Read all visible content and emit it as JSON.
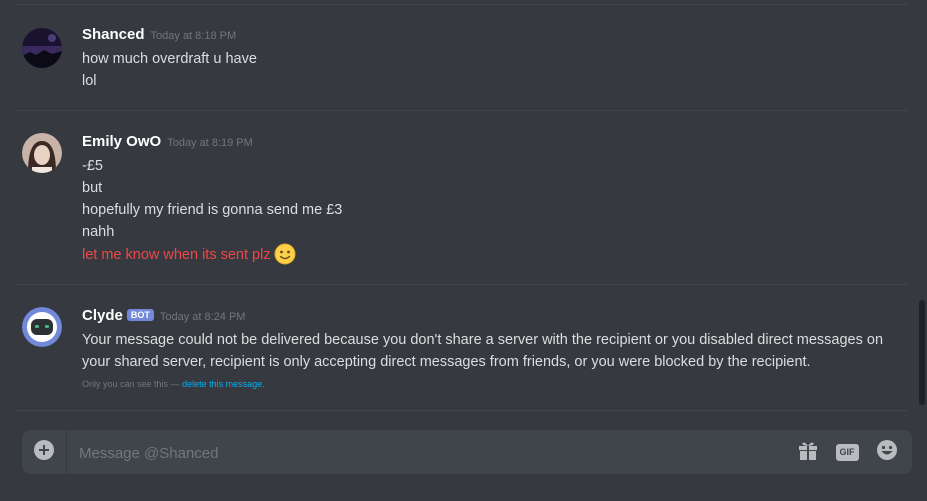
{
  "messages": [
    {
      "username": "Shanced",
      "timestamp": "Today at 8:18 PM",
      "lines": [
        "how much overdraft u have",
        "lol"
      ]
    },
    {
      "username": "Emily OwO",
      "timestamp": "Today at 8:19 PM",
      "lines": [
        "-£5",
        "but",
        "hopefully my friend is gonna send me £3",
        "nahh"
      ],
      "highlight_line": "let me know when its sent plz",
      "emoji": "slightly-smiling-face-icon"
    },
    {
      "username": "Clyde",
      "bot_tag": "BOT",
      "timestamp": "Today at 8:24 PM",
      "text": "Your message could not be delivered because you don't share a server with the recipient or you disabled direct messages on your shared server, recipient is only accepting direct messages from friends, or you were blocked by the recipient.",
      "ephemeral_note": "Only you can see this —",
      "ephemeral_link": "delete this message."
    }
  ],
  "composer": {
    "placeholder": "Message @Shanced",
    "gif_label": "GIF",
    "icons": [
      "add-attachment-icon",
      "gift-icon",
      "gif-icon",
      "emoji-picker-icon"
    ]
  },
  "colors": {
    "background": "#36393f",
    "composer": "#40444b",
    "highlight_text": "#f04747",
    "bot_tag": "#7289da",
    "link": "#00b0f4"
  }
}
